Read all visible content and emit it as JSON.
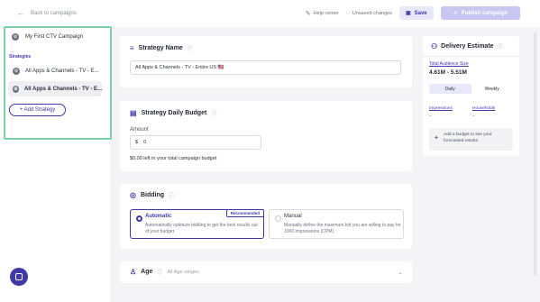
{
  "topbar": {
    "back_label": "Back to campaigns",
    "help_label": "Help center",
    "unsaved_label": "Unsaved changes",
    "save_label": "Save",
    "publish_label": "Publish campaign"
  },
  "sidebar": {
    "campaign_name": "My First CTV Campaign",
    "strategies_heading": "Strategies",
    "items": [
      {
        "label": "All Apps & Channels - TV - E..."
      },
      {
        "label": "All Apps & Channels - TV - E..."
      }
    ],
    "add_label": "+ Add Strategy"
  },
  "strategy_name": {
    "title": "Strategy Name",
    "value": "All Apps & Channels - TV - Entire US 🇺🇸"
  },
  "budget": {
    "title": "Strategy Daily Budget",
    "amount_label": "Amount",
    "currency": "$",
    "value": "0",
    "helper": "$0.00 left in your total campaign budget"
  },
  "bidding": {
    "title": "Bidding",
    "options": [
      {
        "name": "Automatic",
        "badge": "Recommended",
        "description": "Automatically optimize bidding to get the best results out of your budget.",
        "selected": true
      },
      {
        "name": "Manual",
        "description": "Manually define the maximum bid you are willing to pay for 1000 impressions (CPM).",
        "selected": false
      }
    ]
  },
  "age": {
    "title": "Age",
    "summary": "All Age ranges"
  },
  "estimate": {
    "title": "Delivery Estimate",
    "tas_label": "Total Audience Size",
    "tas_value": "4.61M - 5.51M",
    "tabs": [
      "Daily",
      "Weekly"
    ],
    "active_tab": "Daily",
    "impressions_label": "Impressions",
    "impressions_value": "–",
    "households_label": "Households",
    "households_value": "–",
    "hint": "Add a budget to see your forecasted results"
  },
  "colors": {
    "accent": "#3f3aa8",
    "highlight": "#7fcfa8"
  }
}
